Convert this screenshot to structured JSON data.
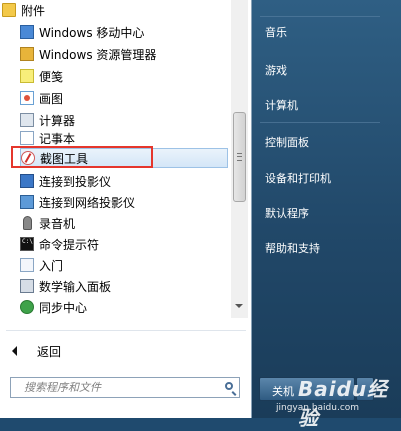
{
  "programs": {
    "folder_label": "附件",
    "items": [
      {
        "label": "Windows 移动中心",
        "icon": "mobility-center-icon"
      },
      {
        "label": "Windows 资源管理器",
        "icon": "explorer-folder-icon"
      },
      {
        "label": "便笺",
        "icon": "sticky-notes-icon"
      },
      {
        "label": "画图",
        "icon": "paint-icon"
      },
      {
        "label": "计算器",
        "icon": "calculator-icon"
      },
      {
        "label": "记事本",
        "icon": "notepad-icon"
      },
      {
        "label": "截图工具",
        "icon": "snipping-tool-icon"
      },
      {
        "label": "连接到投影仪",
        "icon": "projector-icon"
      },
      {
        "label": "连接到网络投影仪",
        "icon": "network-projector-icon"
      },
      {
        "label": "录音机",
        "icon": "microphone-icon"
      },
      {
        "label": "命令提示符",
        "icon": "command-prompt-icon"
      },
      {
        "label": "入门",
        "icon": "getting-started-icon"
      },
      {
        "label": "数学输入面板",
        "icon": "math-input-icon"
      },
      {
        "label": "同步中心",
        "icon": "sync-center-icon"
      }
    ],
    "highlighted_index": 6
  },
  "nav": {
    "back_label": "返回"
  },
  "search": {
    "placeholder": "搜索程序和文件"
  },
  "right_panel": {
    "items": [
      "音乐",
      "游戏",
      "计算机",
      "控制面板",
      "设备和打印机",
      "默认程序",
      "帮助和支持"
    ]
  },
  "shutdown": {
    "label": "关机"
  },
  "watermark": {
    "main": "Baidu经验",
    "sub": "jingyan.baidu.com"
  },
  "colors": {
    "highlight_box": "#e5362c",
    "right_panel": "#214869"
  }
}
